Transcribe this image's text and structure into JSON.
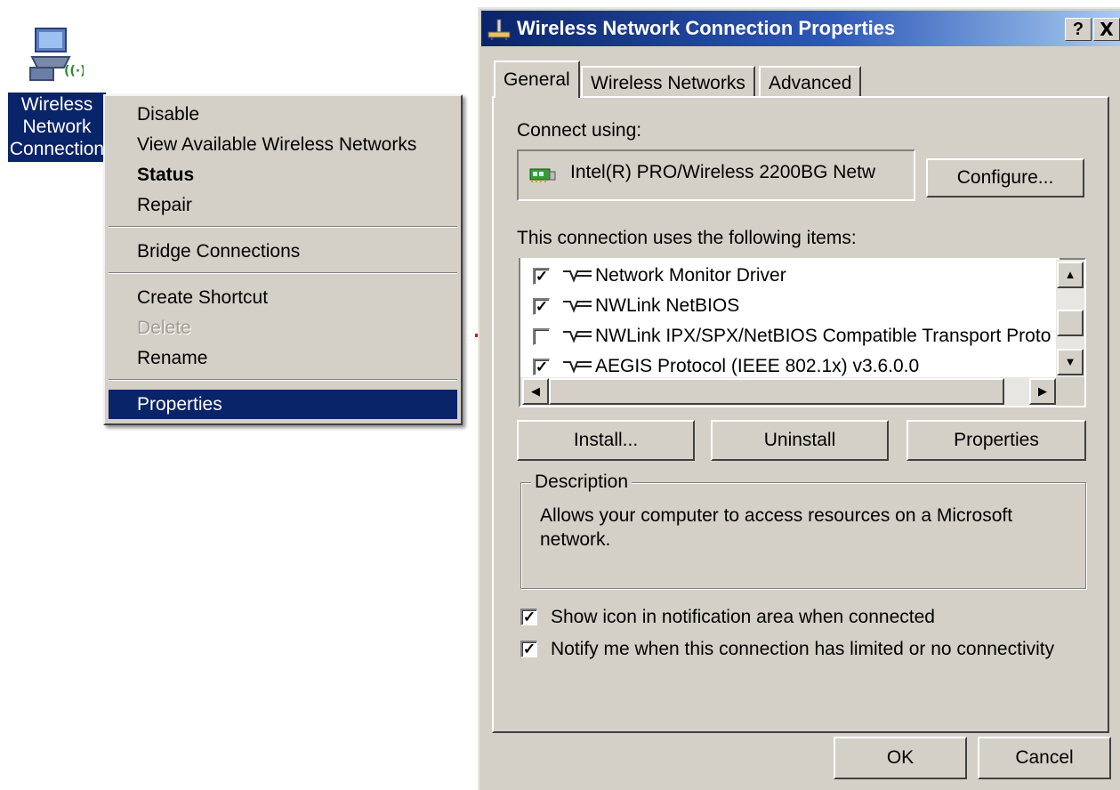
{
  "desktop_icon": {
    "label_lines": [
      "Wireless",
      "Network",
      "Connection"
    ],
    "icon": "network-computer-icon"
  },
  "context_menu": {
    "items": [
      {
        "label": "Disable",
        "disabled": false
      },
      {
        "label": "View Available Wireless Networks",
        "disabled": false
      },
      {
        "label": "Status",
        "bold": true
      },
      {
        "label": "Repair",
        "disabled": false
      },
      {
        "label": "Bridge Connections",
        "disabled": false
      },
      {
        "label": "Create Shortcut",
        "disabled": false
      },
      {
        "label": "Delete",
        "disabled": true
      },
      {
        "label": "Rename",
        "disabled": false
      },
      {
        "label": "Properties",
        "selected": true
      }
    ]
  },
  "dialog": {
    "title": "Wireless Network Connection Properties",
    "help_button": "?",
    "close_button": "X",
    "tabs": [
      {
        "label": "General",
        "active": true
      },
      {
        "label": "Wireless Networks",
        "active": false
      },
      {
        "label": "Advanced",
        "active": false
      }
    ],
    "connect_using_label": "Connect using:",
    "adapter_name": "Intel(R) PRO/Wireless 2200BG Netw",
    "configure_button": "Configure...",
    "items_label": "This connection uses the following items:",
    "items": [
      {
        "label": "Network Monitor Driver",
        "checked": true
      },
      {
        "label": "NWLink NetBIOS",
        "checked": true
      },
      {
        "label": "NWLink IPX/SPX/NetBIOS Compatible Transport Proto",
        "checked": false
      },
      {
        "label": "AEGIS Protocol (IEEE 802.1x) v3.6.0.0",
        "checked": true
      }
    ],
    "install_button": "Install...",
    "uninstall_button": "Uninstall",
    "properties_button": "Properties",
    "description_title": "Description",
    "description_text_lines": [
      "Allows your computer to access resources on a Microsoft",
      "network."
    ],
    "show_icon_label": "Show icon in notification area when connected",
    "show_icon_checked": true,
    "notify_label": "Notify me when this connection has limited or no connectivity",
    "notify_checked": true,
    "ok_button": "OK",
    "cancel_button": "Cancel"
  },
  "colors": {
    "face": "#d4d0c8",
    "selection": "#0a246a",
    "titlebar_start": "#0a246a",
    "titlebar_end": "#a6caf0",
    "annotation_arrow": "#e01010"
  }
}
